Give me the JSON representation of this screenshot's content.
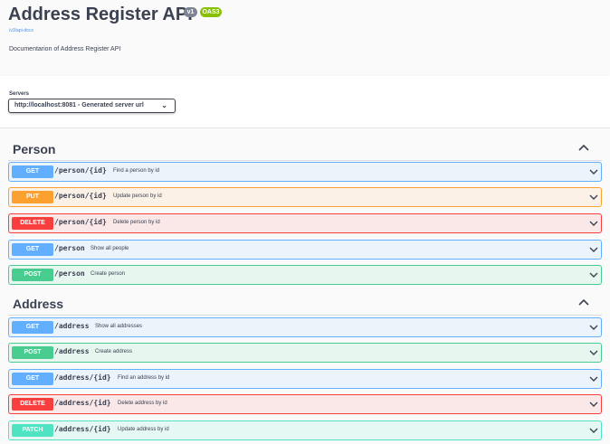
{
  "info": {
    "title": "Address Register API",
    "version_badge": "v1",
    "oas_badge": "OAS3",
    "doc_link": "/v3/api-docs",
    "description": "Documentarion of Address Register API"
  },
  "servers": {
    "label": "Servers",
    "selected": "http://localhost:8081 - Generated server url"
  },
  "colors": {
    "get": "#61affe",
    "put": "#fca130",
    "delete": "#f93e3e",
    "post": "#49cc90",
    "patch": "#50e3c2"
  },
  "tags": [
    {
      "name": "Person",
      "operations": [
        {
          "method": "GET",
          "path": "/person/{id}",
          "summary": "Find a person by id"
        },
        {
          "method": "PUT",
          "path": "/person/{id}",
          "summary": "Update person by id"
        },
        {
          "method": "DELETE",
          "path": "/person/{id}",
          "summary": "Delete person by id"
        },
        {
          "method": "GET",
          "path": "/person",
          "summary": "Show all people"
        },
        {
          "method": "POST",
          "path": "/person",
          "summary": "Create person"
        }
      ]
    },
    {
      "name": "Address",
      "operations": [
        {
          "method": "GET",
          "path": "/address",
          "summary": "Show all addresses"
        },
        {
          "method": "POST",
          "path": "/address",
          "summary": "Create address"
        },
        {
          "method": "GET",
          "path": "/address/{id}",
          "summary": "Find an address by id"
        },
        {
          "method": "DELETE",
          "path": "/address/{id}",
          "summary": "Delete address by id"
        },
        {
          "method": "PATCH",
          "path": "/address/{id}",
          "summary": "Update address by id"
        }
      ]
    }
  ]
}
